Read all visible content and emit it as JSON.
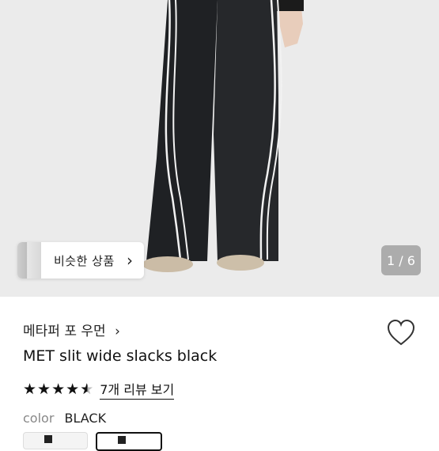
{
  "gallery": {
    "similar_label": "비슷한 상품",
    "similar_chevron": "›",
    "page_indicator": "1 / 6"
  },
  "product": {
    "store_name": "메타퍼 포 우먼",
    "store_chevron": "›",
    "title": "MET slit wide slacks black",
    "rating": 4.5,
    "review_link": "7개 리뷰 보기",
    "color_label": "color",
    "color_value": "BLACK"
  },
  "icons": {
    "heart": "heart-outline-icon",
    "star": "star-icon",
    "chevron": "chevron-right-icon"
  }
}
